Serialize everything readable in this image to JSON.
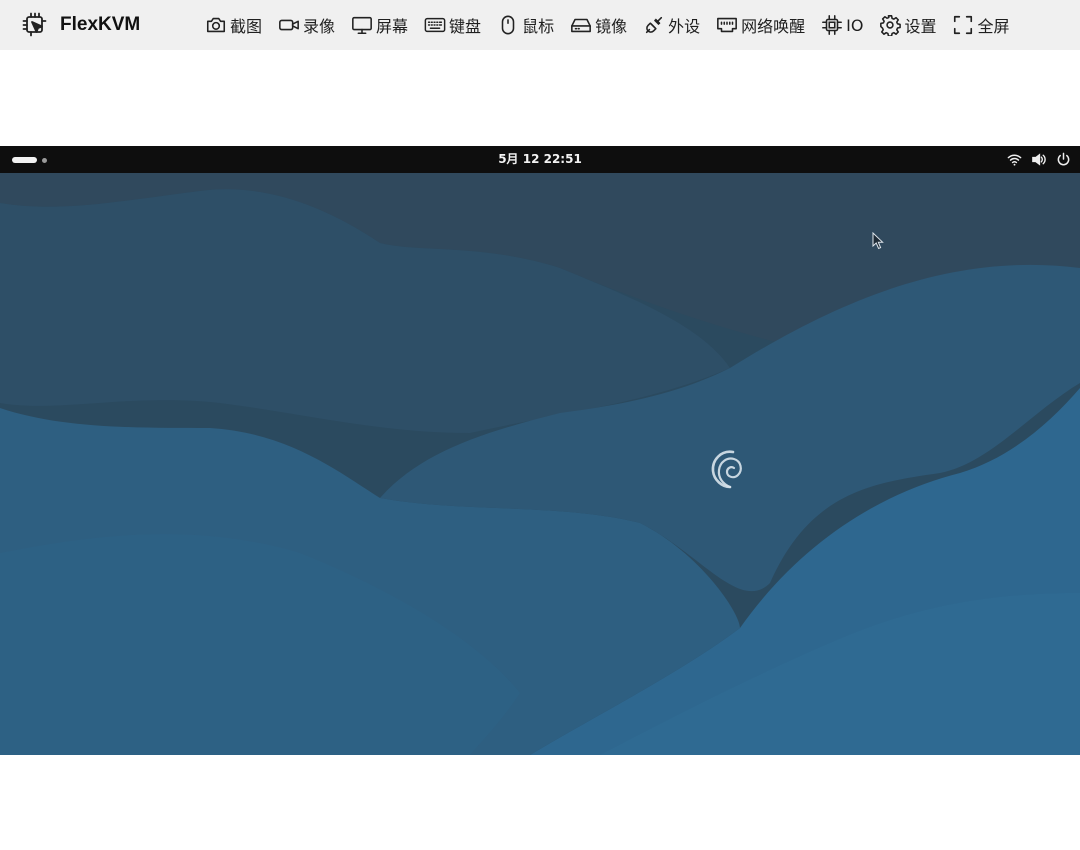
{
  "app": {
    "name": "FlexKVM",
    "icon": "chip-cursor-icon"
  },
  "toolbar": {
    "items": [
      {
        "label": "截图",
        "icon": "camera-icon"
      },
      {
        "label": "录像",
        "icon": "video-icon"
      },
      {
        "label": "屏幕",
        "icon": "monitor-icon"
      },
      {
        "label": "键盘",
        "icon": "keyboard-icon"
      },
      {
        "label": "鼠标",
        "icon": "mouse-icon"
      },
      {
        "label": "镜像",
        "icon": "drive-icon"
      },
      {
        "label": "外设",
        "icon": "plug-icon"
      },
      {
        "label": "网络唤醒",
        "icon": "ethernet-icon"
      },
      {
        "label": "IO",
        "icon": "chip-icon"
      },
      {
        "label": "设置",
        "icon": "gear-icon"
      },
      {
        "label": "全屏",
        "icon": "fullscreen-icon"
      }
    ]
  },
  "remote": {
    "topbar": {
      "clock": "5月 12  22:51",
      "tray_icons": [
        "wifi-icon",
        "volume-icon",
        "power-icon"
      ]
    },
    "desktop": {
      "logo": "debian-swirl-icon",
      "cursor": "mouse-pointer-icon"
    }
  },
  "colors": {
    "header_bg": "#f0f0f0",
    "remote_topbar": "#0e0e0e",
    "wallpaper_dark": "#2b4a5f",
    "wallpaper_light": "#2f6a90"
  }
}
